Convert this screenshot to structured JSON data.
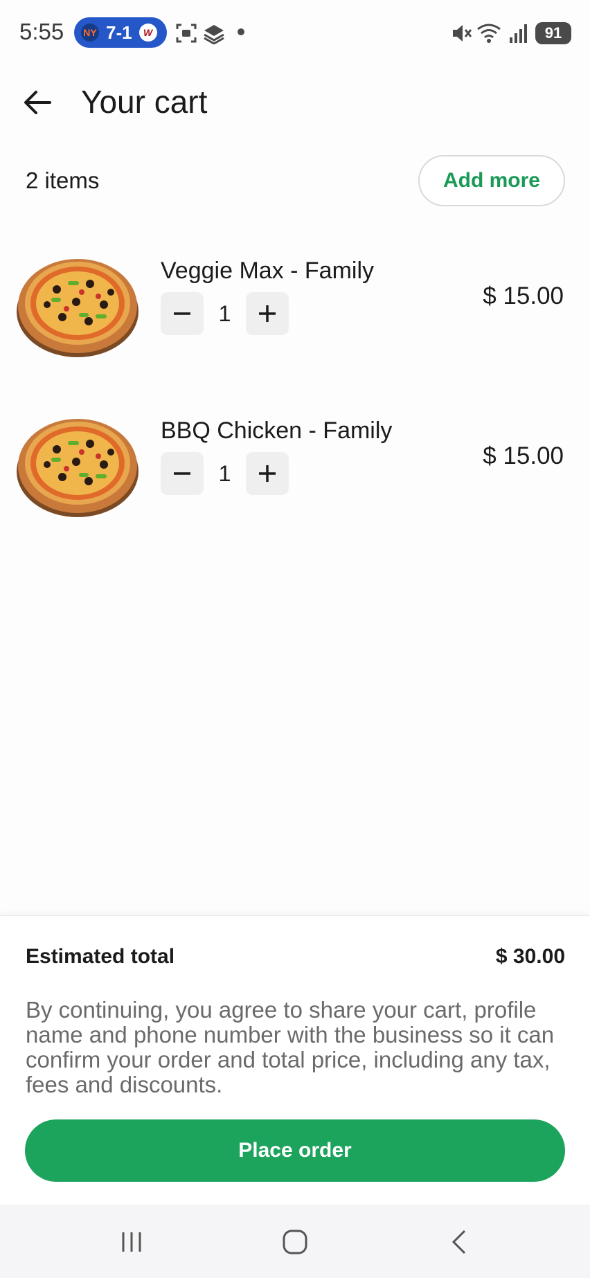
{
  "status_bar": {
    "time": "5:55",
    "score": "7-1",
    "team_a_badge": "NY",
    "team_b_badge": "W",
    "battery": "91",
    "signal_icons": [
      "screenshot-icon",
      "stack-icon",
      "notification-dot-icon",
      "mute-icon",
      "wifi-icon",
      "signal-icon"
    ]
  },
  "header": {
    "title": "Your cart"
  },
  "cart": {
    "items_count": "2 items",
    "add_more_label": "Add more",
    "items": [
      {
        "name": "Veggie Max - Family",
        "quantity": "1",
        "price": "$ 15.00"
      },
      {
        "name": "BBQ Chicken - Family",
        "quantity": "1",
        "price": "$ 15.00"
      }
    ]
  },
  "summary": {
    "estimated_total_label": "Estimated total",
    "estimated_total_value": "$ 30.00",
    "disclaimer": "By continuing, you agree to share your cart, profile name and phone number with the business so it can confirm your order and total price, including any tax, fees and discounts.",
    "place_order_label": "Place order"
  },
  "colors": {
    "accent_green": "#1ca35c",
    "text_dark": "#1b1b1b",
    "text_muted": "#6a6a6a"
  }
}
